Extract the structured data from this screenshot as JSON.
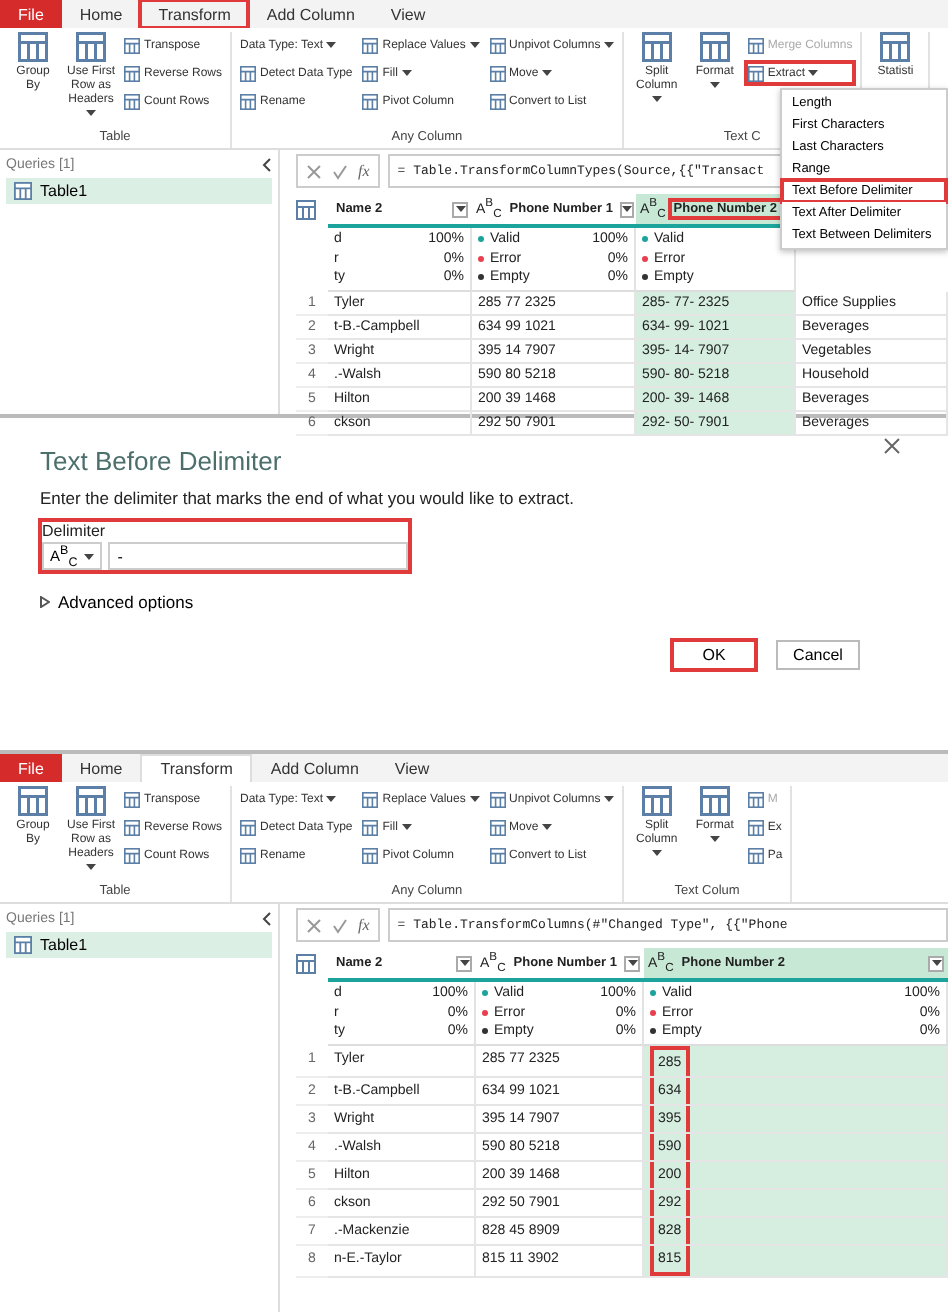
{
  "editor_before": {
    "tabs": [
      {
        "label": "File",
        "kind": "file",
        "selected": false,
        "callout": false
      },
      {
        "label": "Home",
        "kind": "tab",
        "selected": false,
        "callout": false
      },
      {
        "label": "Transform",
        "kind": "tab",
        "selected": false,
        "callout": true
      },
      {
        "label": "Add Column",
        "kind": "tab",
        "selected": false,
        "callout": false
      },
      {
        "label": "View",
        "kind": "tab",
        "selected": false,
        "callout": false
      }
    ],
    "ribbon": [
      {
        "label": "Table",
        "items": [
          {
            "label": "Group By",
            "kind": "large",
            "dropdown": false,
            "disabled": false,
            "callout": false
          },
          {
            "label": "Use First Row as Headers",
            "kind": "large",
            "dropdown": true,
            "disabled": false,
            "callout": false
          },
          {
            "label": "Transpose",
            "kind": "small",
            "dropdown": false,
            "disabled": false,
            "callout": false
          },
          {
            "label": "Reverse Rows",
            "kind": "small",
            "dropdown": false,
            "disabled": false,
            "callout": false
          },
          {
            "label": "Count Rows",
            "kind": "small",
            "dropdown": false,
            "disabled": false,
            "callout": false
          }
        ]
      },
      {
        "label": "Any Column",
        "items": [
          {
            "label": "Data Type: Text",
            "kind": "plain",
            "dropdown": true,
            "disabled": false,
            "callout": false
          },
          {
            "label": "Detect Data Type",
            "kind": "small",
            "dropdown": false,
            "disabled": false,
            "callout": false
          },
          {
            "label": "Rename",
            "kind": "small",
            "dropdown": false,
            "disabled": false,
            "callout": false
          },
          {
            "label": "Replace Values",
            "kind": "small",
            "dropdown": true,
            "disabled": false,
            "callout": false
          },
          {
            "label": "Fill",
            "kind": "small",
            "dropdown": true,
            "disabled": false,
            "callout": false
          },
          {
            "label": "Pivot Column",
            "kind": "small",
            "dropdown": false,
            "disabled": false,
            "callout": false
          },
          {
            "label": "Unpivot Columns",
            "kind": "small",
            "dropdown": true,
            "disabled": false,
            "callout": false
          },
          {
            "label": "Move",
            "kind": "small",
            "dropdown": true,
            "disabled": false,
            "callout": false
          },
          {
            "label": "Convert to List",
            "kind": "small",
            "dropdown": false,
            "disabled": false,
            "callout": false
          }
        ]
      },
      {
        "label": "Text C",
        "items": [
          {
            "label": "Split Column",
            "kind": "large",
            "dropdown": true,
            "disabled": false,
            "callout": false
          },
          {
            "label": "Format",
            "kind": "large",
            "dropdown": true,
            "disabled": false,
            "callout": false
          },
          {
            "label": "Merge Columns",
            "kind": "small",
            "dropdown": false,
            "disabled": true,
            "callout": false
          },
          {
            "label": "Extract",
            "kind": "small",
            "dropdown": true,
            "disabled": false,
            "callout": true
          }
        ]
      },
      {
        "items": [
          {
            "label": "Statisti",
            "kind": "large",
            "dropdown": false,
            "disabled": false,
            "callout": false
          }
        ]
      }
    ],
    "menu": [
      {
        "label": "Length",
        "callout": false
      },
      {
        "label": "First Characters",
        "callout": false
      },
      {
        "label": "Last Characters",
        "callout": false
      },
      {
        "label": "Range",
        "callout": false
      },
      {
        "label": "Text Before Delimiter",
        "callout": true
      },
      {
        "label": "Text After Delimiter",
        "callout": false
      },
      {
        "label": "Text Between Delimiters",
        "callout": false
      }
    ],
    "queries": {
      "title": "Queries [1]",
      "items": [
        {
          "label": "Table1",
          "selected": true
        }
      ]
    },
    "formula": {
      "fx_label": "fx",
      "text": "= Table.TransformColumnTypes(Source,{{\"Transact"
    },
    "columns": [
      {
        "label": "Name 2",
        "filter_button": true,
        "selected": false,
        "header_callout": false,
        "cells_callout": false,
        "profile": [
          {
            "label": "d",
            "pct": "100%"
          },
          {
            "label": "r",
            "pct": "0%"
          },
          {
            "label": "ty",
            "pct": "0%"
          }
        ]
      },
      {
        "label": "Phone Number 1",
        "type_label": "A$^{B}$$_{C}$",
        "filter_button": true,
        "selected": false,
        "header_callout": false,
        "cells_callout": false,
        "profile": [
          {
            "label": "Valid",
            "pct": "100%",
            "color": "#1ba39c"
          },
          {
            "label": "Error",
            "pct": "0%",
            "color": "#e8404f"
          },
          {
            "label": "Empty",
            "pct": "0%",
            "color": "#333333"
          }
        ]
      },
      {
        "label": "Phone Number 2",
        "type_label": "A$^{B}$$_{C}$",
        "filter_button": false,
        "selected": true,
        "header_callout": true,
        "cells_callout": false,
        "profile": [
          {
            "label": "Valid",
            "color": "#1ba39c"
          },
          {
            "label": "Error",
            "color": "#e8404f"
          },
          {
            "label": "Empty",
            "color": "#333333"
          }
        ]
      },
      {
        "selected": false,
        "cells_callout": false
      }
    ],
    "rows": [
      {
        "number": "1",
        "cells": [
          "Tyler",
          "285 77 2325",
          "285- 77- 2325",
          "Office Supplies"
        ]
      },
      {
        "number": "2",
        "cells": [
          "t-B.-Campbell",
          "634 99 1021",
          "634- 99- 1021",
          "Beverages"
        ]
      },
      {
        "number": "3",
        "cells": [
          "Wright",
          "395 14 7907",
          "395- 14- 7907",
          "Vegetables"
        ]
      },
      {
        "number": "4",
        "cells": [
          ".-Walsh",
          "590 80 5218",
          "590- 80- 5218",
          "Household"
        ]
      },
      {
        "number": "5",
        "cells": [
          "Hilton",
          "200 39 1468",
          "200- 39- 1468",
          "Beverages"
        ]
      },
      {
        "number": "6",
        "cells": [
          "ckson",
          "292 50 7901",
          "292- 50- 7901",
          "Beverages"
        ]
      }
    ]
  },
  "dialog": {
    "title": "Text Before Delimiter",
    "description": "Enter the delimiter that marks the end of what you would like to extract.",
    "delimiter": {
      "label": "Delimiter",
      "type_label": "A$^{B}$$_{C}$",
      "value": "-",
      "callout": true
    },
    "advanced": {
      "label": "Advanced options",
      "expanded": false
    },
    "buttons": [
      {
        "label": "OK",
        "kind": "primary",
        "callout": true
      },
      {
        "label": "Cancel",
        "kind": "secondary",
        "callout": false
      }
    ]
  },
  "editor_after": {
    "tabs": [
      {
        "label": "File",
        "kind": "file",
        "selected": false,
        "callout": false
      },
      {
        "label": "Home",
        "kind": "tab",
        "selected": false,
        "callout": false
      },
      {
        "label": "Transform",
        "kind": "tab",
        "selected": true,
        "callout": false
      },
      {
        "label": "Add Column",
        "kind": "tab",
        "selected": false,
        "callout": false
      },
      {
        "label": "View",
        "kind": "tab",
        "selected": false,
        "callout": false
      }
    ],
    "ribbon": [
      {
        "label": "Table",
        "items": [
          {
            "label": "Group By",
            "kind": "large",
            "dropdown": false,
            "disabled": false,
            "callout": false
          },
          {
            "label": "Use First Row as Headers",
            "kind": "large",
            "dropdown": true,
            "disabled": false,
            "callout": false
          },
          {
            "label": "Transpose",
            "kind": "small",
            "dropdown": false,
            "disabled": false,
            "callout": false
          },
          {
            "label": "Reverse Rows",
            "kind": "small",
            "dropdown": false,
            "disabled": false,
            "callout": false
          },
          {
            "label": "Count Rows",
            "kind": "small",
            "dropdown": false,
            "disabled": false,
            "callout": false
          }
        ]
      },
      {
        "label": "Any Column",
        "items": [
          {
            "label": "Data Type: Text",
            "kind": "plain",
            "dropdown": true,
            "disabled": false,
            "callout": false
          },
          {
            "label": "Detect Data Type",
            "kind": "small",
            "dropdown": false,
            "disabled": false,
            "callout": false
          },
          {
            "label": "Rename",
            "kind": "small",
            "dropdown": false,
            "disabled": false,
            "callout": false
          },
          {
            "label": "Replace Values",
            "kind": "small",
            "dropdown": true,
            "disabled": false,
            "callout": false
          },
          {
            "label": "Fill",
            "kind": "small",
            "dropdown": true,
            "disabled": false,
            "callout": false
          },
          {
            "label": "Pivot Column",
            "kind": "small",
            "dropdown": false,
            "disabled": false,
            "callout": false
          },
          {
            "label": "Unpivot Columns",
            "kind": "small",
            "dropdown": true,
            "disabled": false,
            "callout": false
          },
          {
            "label": "Move",
            "kind": "small",
            "dropdown": true,
            "disabled": false,
            "callout": false
          },
          {
            "label": "Convert to List",
            "kind": "small",
            "dropdown": false,
            "disabled": false,
            "callout": false
          }
        ]
      },
      {
        "label": "Text Colum",
        "items": [
          {
            "label": "Split Column",
            "kind": "large",
            "dropdown": true,
            "disabled": false,
            "callout": false
          },
          {
            "label": "Format",
            "kind": "large",
            "dropdown": true,
            "disabled": false,
            "callout": false
          },
          {
            "label": "M",
            "kind": "small",
            "dropdown": false,
            "disabled": true,
            "callout": false
          },
          {
            "label": "Ex",
            "kind": "small",
            "dropdown": false,
            "disabled": false,
            "callout": false
          },
          {
            "label": "Pa",
            "kind": "small",
            "dropdown": false,
            "disabled": false,
            "callout": false
          }
        ]
      }
    ],
    "queries": {
      "title": "Queries [1]",
      "items": [
        {
          "label": "Table1",
          "selected": true
        }
      ]
    },
    "formula": {
      "fx_label": "fx",
      "text": "= Table.TransformColumns(#\"Changed Type\", {{\"Phone"
    },
    "columns": [
      {
        "label": "Name 2",
        "filter_button": true,
        "selected": false,
        "header_callout": false,
        "cells_callout": false,
        "profile": [
          {
            "label": "d",
            "pct": "100%"
          },
          {
            "label": "r",
            "pct": "0%"
          },
          {
            "label": "ty",
            "pct": "0%"
          }
        ]
      },
      {
        "label": "Phone Number 1",
        "type_label": "A$^{B}$$_{C}$",
        "filter_button": true,
        "selected": false,
        "header_callout": false,
        "cells_callout": false,
        "profile": [
          {
            "label": "Valid",
            "pct": "100%",
            "color": "#1ba39c"
          },
          {
            "label": "Error",
            "pct": "0%",
            "color": "#e8404f"
          },
          {
            "label": "Empty",
            "pct": "0%",
            "color": "#333333"
          }
        ]
      },
      {
        "label": "Phone Number 2",
        "type_label": "A$^{B}$$_{C}$",
        "filter_button": true,
        "selected": true,
        "header_callout": false,
        "cells_callout": true,
        "profile": [
          {
            "label": "Valid",
            "pct": "100%",
            "color": "#1ba39c"
          },
          {
            "label": "Error",
            "pct": "0%",
            "color": "#e8404f"
          },
          {
            "label": "Empty",
            "pct": "0%",
            "color": "#333333"
          }
        ]
      }
    ],
    "rows": [
      {
        "number": "1",
        "cells": [
          "Tyler",
          "285 77 2325",
          "285"
        ]
      },
      {
        "number": "2",
        "cells": [
          "t-B.-Campbell",
          "634 99 1021",
          "634"
        ]
      },
      {
        "number": "3",
        "cells": [
          "Wright",
          "395 14 7907",
          "395"
        ]
      },
      {
        "number": "4",
        "cells": [
          ".-Walsh",
          "590 80 5218",
          "590"
        ]
      },
      {
        "number": "5",
        "cells": [
          "Hilton",
          "200 39 1468",
          "200"
        ]
      },
      {
        "number": "6",
        "cells": [
          "ckson",
          "292 50 7901",
          "292"
        ]
      },
      {
        "number": "7",
        "cells": [
          ".-Mackenzie",
          "828 45 8909",
          "828"
        ]
      },
      {
        "number": "8",
        "cells": [
          "n-E.-Taylor",
          "815 11 3902",
          "815"
        ]
      }
    ]
  }
}
